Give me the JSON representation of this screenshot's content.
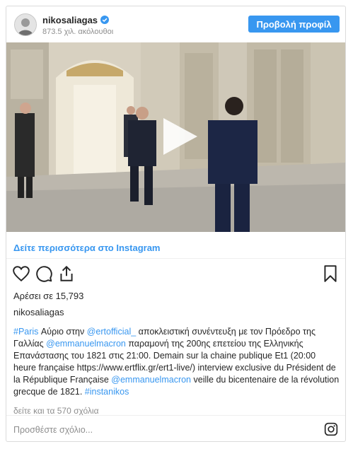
{
  "header": {
    "username": "nikosaliagas",
    "followers": "873.5 χιλ. ακόλουθοι",
    "profile_button": "Προβολή προφίλ"
  },
  "media": {
    "type": "video",
    "play_icon": "play-icon"
  },
  "view_more_link": "Δείτε περισσότερα στο Instagram",
  "actions": {
    "icons": [
      "heart-icon",
      "comment-icon",
      "share-icon",
      "bookmark-icon"
    ]
  },
  "likes": "Αρέσει σε 15,793",
  "owner_name": "nikosaliagas",
  "caption": {
    "hashtag_paris": "#Paris",
    "text1": " Αύριο στην ",
    "mention_ert": "@ertofficial_",
    "text2": " αποκλειστική συνέντευξη με τον Πρόεδρο της Γαλλίας ",
    "mention_macron1": "@emmanuelmacron",
    "text3": " παραμονή της 200ης επετείου της Ελληνικής Επανάστασης του 1821 στις 21:00. Demain sur la chaine publique Et1 (20:00 heure française https://www.ertflix.gr/ert1-live/) interview exclusive du Président de la République Française ",
    "mention_macron2": "@emmanuelmacron",
    "text4": " veille du bicentenaire de la révolution grecque de 1821. ",
    "hashtag_instanikos": "#instanikos"
  },
  "comments_link": "δείτε και τα 570 σχόλια",
  "add_comment_placeholder": "Προσθέστε σχόλιο...",
  "colors": {
    "accent": "#3897f0",
    "text": "#262626",
    "muted": "#8e8e8e",
    "border": "#dbdbdb"
  }
}
